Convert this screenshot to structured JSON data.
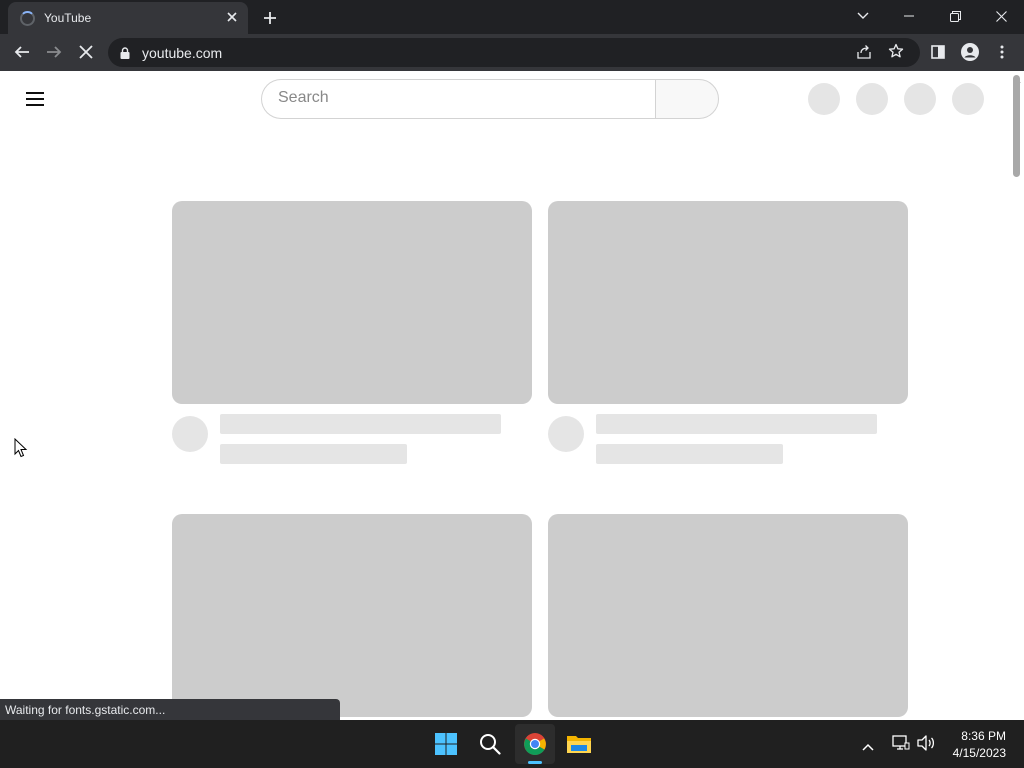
{
  "browser": {
    "tab_title": "YouTube",
    "url": "youtube.com",
    "status_text": "Waiting for fonts.gstatic.com...",
    "accent_color": "#8ab4f8"
  },
  "page": {
    "search_placeholder": "Search",
    "loading_state": "skeleton placeholders",
    "placeholder_color": "#cccccc"
  },
  "taskbar": {
    "apps": [
      "start-icon",
      "search-icon",
      "chrome-icon",
      "file-explorer-icon"
    ],
    "active_app": "chrome-icon",
    "time": "8:36 PM",
    "date": "4/15/2023"
  },
  "icons": {
    "tray": [
      "chevron-up-icon",
      "network-icon",
      "volume-icon"
    ]
  }
}
